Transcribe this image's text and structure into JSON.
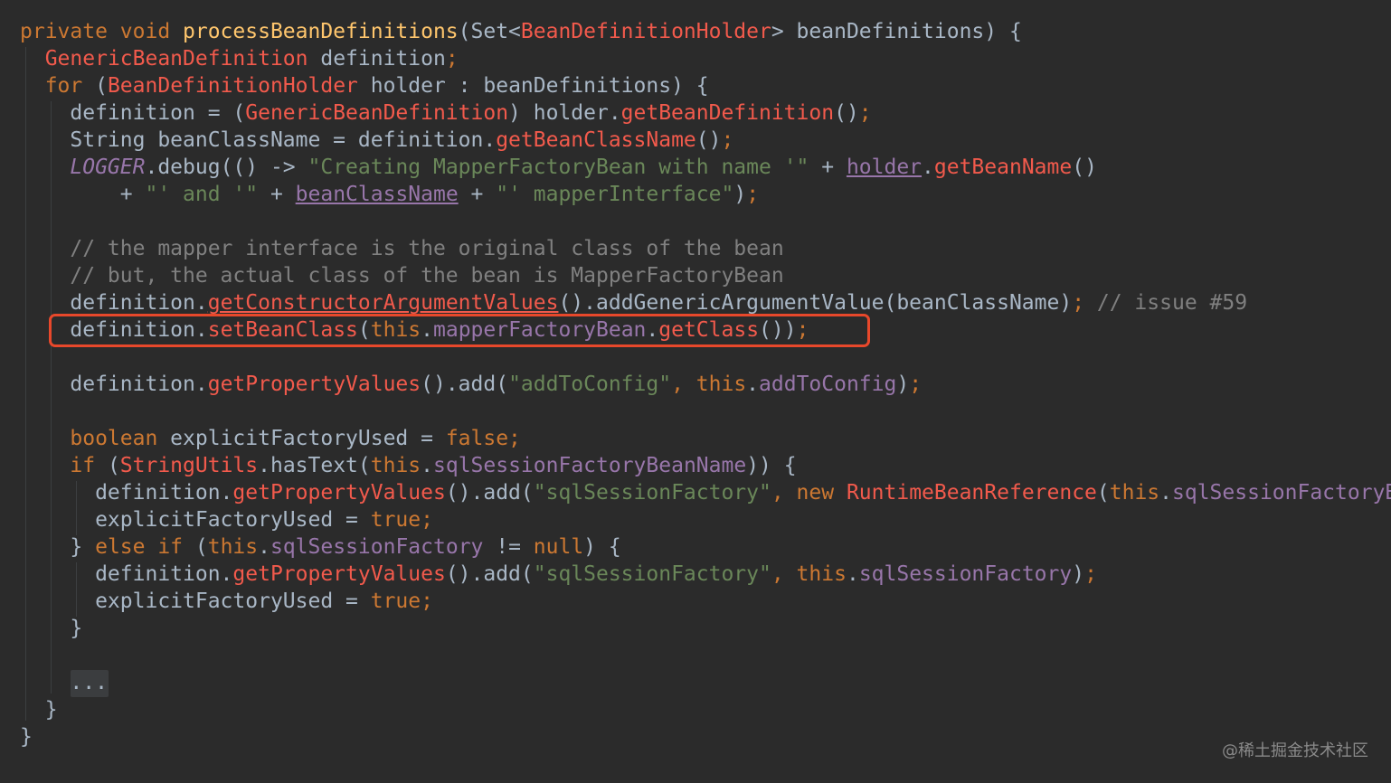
{
  "editor": {
    "colors": {
      "background": "#2b2b2b",
      "keyword": "#cc7832",
      "plain": "#a9b7c6",
      "string": "#6a8759",
      "field": "#9876aa",
      "method": "#ffc66d",
      "call": "#f25a4c",
      "comment": "#808080",
      "highlight_border": "#e8482b"
    },
    "highlighted_line": 12,
    "fold_marker": "...",
    "watermark": "@稀土掘金技术社区"
  },
  "code_lines": [
    [
      [
        "kw",
        "private void "
      ],
      [
        "method",
        "processBeanDefinitions"
      ],
      [
        "plain",
        "(Set<"
      ],
      [
        "type",
        "BeanDefinitionHolder"
      ],
      [
        "plain",
        "> beanDefinitions) {"
      ]
    ],
    [
      [
        "plain",
        "  "
      ],
      [
        "type",
        "GenericBeanDefinition"
      ],
      [
        "plain",
        " definition"
      ],
      [
        "kw",
        ";"
      ]
    ],
    [
      [
        "plain",
        "  "
      ],
      [
        "kw",
        "for "
      ],
      [
        "plain",
        "("
      ],
      [
        "type",
        "BeanDefinitionHolder"
      ],
      [
        "plain",
        " holder : beanDefinitions) {"
      ]
    ],
    [
      [
        "plain",
        "    definition = ("
      ],
      [
        "type",
        "GenericBeanDefinition"
      ],
      [
        "plain",
        ") holder."
      ],
      [
        "call",
        "getBeanDefinition"
      ],
      [
        "plain",
        "()"
      ],
      [
        "kw",
        ";"
      ]
    ],
    [
      [
        "plain",
        "    String beanClassName = definition."
      ],
      [
        "call",
        "getBeanClassName"
      ],
      [
        "plain",
        "()"
      ],
      [
        "kw",
        ";"
      ]
    ],
    [
      [
        "plain",
        "    "
      ],
      [
        "static",
        "LOGGER"
      ],
      [
        "plain",
        ".debug(() -> "
      ],
      [
        "str",
        "\"Creating MapperFactoryBean with name '\""
      ],
      [
        "plain",
        " + "
      ],
      [
        "under",
        "holder"
      ],
      [
        "plain",
        "."
      ],
      [
        "call",
        "getBeanName"
      ],
      [
        "plain",
        "()"
      ]
    ],
    [
      [
        "plain",
        "        + "
      ],
      [
        "str",
        "\"' and '\""
      ],
      [
        "plain",
        " + "
      ],
      [
        "under",
        "beanClassName"
      ],
      [
        "plain",
        " + "
      ],
      [
        "str",
        "\"' mapperInterface\""
      ],
      [
        "plain",
        ")"
      ],
      [
        "kw",
        ";"
      ]
    ],
    [],
    [
      [
        "plain",
        "    "
      ],
      [
        "comment",
        "// the mapper interface is the original class of the bean"
      ]
    ],
    [
      [
        "plain",
        "    "
      ],
      [
        "comment",
        "// but, the actual class of the bean is MapperFactoryBean"
      ]
    ],
    [
      [
        "plain",
        "    definition."
      ],
      [
        "callu",
        "getConstructorArgumentValues"
      ],
      [
        "plain",
        "().addGenericArgumentValue(beanClassName)"
      ],
      [
        "kw",
        "; "
      ],
      [
        "comment",
        "// issue #59"
      ]
    ],
    [
      [
        "plain",
        "    definition."
      ],
      [
        "call",
        "setBeanClass"
      ],
      [
        "plain",
        "("
      ],
      [
        "kw",
        "this"
      ],
      [
        "plain",
        "."
      ],
      [
        "field",
        "mapperFactoryBean"
      ],
      [
        "plain",
        "."
      ],
      [
        "call",
        "getClass"
      ],
      [
        "plain",
        "())"
      ],
      [
        "kw",
        ";"
      ]
    ],
    [],
    [
      [
        "plain",
        "    definition."
      ],
      [
        "call",
        "getPropertyValues"
      ],
      [
        "plain",
        "().add("
      ],
      [
        "str",
        "\"addToConfig\""
      ],
      [
        "kw",
        ", this"
      ],
      [
        "plain",
        "."
      ],
      [
        "field",
        "addToConfig"
      ],
      [
        "plain",
        ")"
      ],
      [
        "kw",
        ";"
      ]
    ],
    [],
    [
      [
        "plain",
        "    "
      ],
      [
        "kw",
        "boolean "
      ],
      [
        "plain",
        "explicitFactoryUsed = "
      ],
      [
        "kw",
        "false;"
      ]
    ],
    [
      [
        "plain",
        "    "
      ],
      [
        "kw",
        "if "
      ],
      [
        "plain",
        "("
      ],
      [
        "type",
        "StringUtils"
      ],
      [
        "plain",
        ".hasText("
      ],
      [
        "kw",
        "this"
      ],
      [
        "plain",
        "."
      ],
      [
        "field",
        "sqlSessionFactoryBeanName"
      ],
      [
        "plain",
        ")) {"
      ]
    ],
    [
      [
        "plain",
        "      definition."
      ],
      [
        "call",
        "getPropertyValues"
      ],
      [
        "plain",
        "().add("
      ],
      [
        "str",
        "\"sqlSessionFactory\""
      ],
      [
        "kw",
        ", new "
      ],
      [
        "type",
        "RuntimeBeanReference"
      ],
      [
        "plain",
        "("
      ],
      [
        "kw",
        "this"
      ],
      [
        "plain",
        "."
      ],
      [
        "field",
        "sqlSessionFactoryBeanName"
      ],
      [
        "plain",
        "))"
      ],
      [
        "kw",
        ";"
      ]
    ],
    [
      [
        "plain",
        "      explicitFactoryUsed = "
      ],
      [
        "kw",
        "true;"
      ]
    ],
    [
      [
        "plain",
        "    } "
      ],
      [
        "kw",
        "else if "
      ],
      [
        "plain",
        "("
      ],
      [
        "kw",
        "this"
      ],
      [
        "plain",
        "."
      ],
      [
        "field",
        "sqlSessionFactory"
      ],
      [
        "plain",
        " != "
      ],
      [
        "kw",
        "null"
      ],
      [
        "plain",
        ") {"
      ]
    ],
    [
      [
        "plain",
        "      definition."
      ],
      [
        "call",
        "getPropertyValues"
      ],
      [
        "plain",
        "().add("
      ],
      [
        "str",
        "\"sqlSessionFactory\""
      ],
      [
        "kw",
        ", this"
      ],
      [
        "plain",
        "."
      ],
      [
        "field",
        "sqlSessionFactory"
      ],
      [
        "plain",
        ")"
      ],
      [
        "kw",
        ";"
      ]
    ],
    [
      [
        "plain",
        "      explicitFactoryUsed = "
      ],
      [
        "kw",
        "true;"
      ]
    ],
    [
      [
        "plain",
        "    }"
      ]
    ],
    [],
    [
      [
        "plain",
        "    "
      ],
      [
        "fold",
        "..."
      ]
    ],
    [
      [
        "plain",
        "  }"
      ]
    ],
    [
      [
        "plain",
        "}"
      ]
    ]
  ]
}
